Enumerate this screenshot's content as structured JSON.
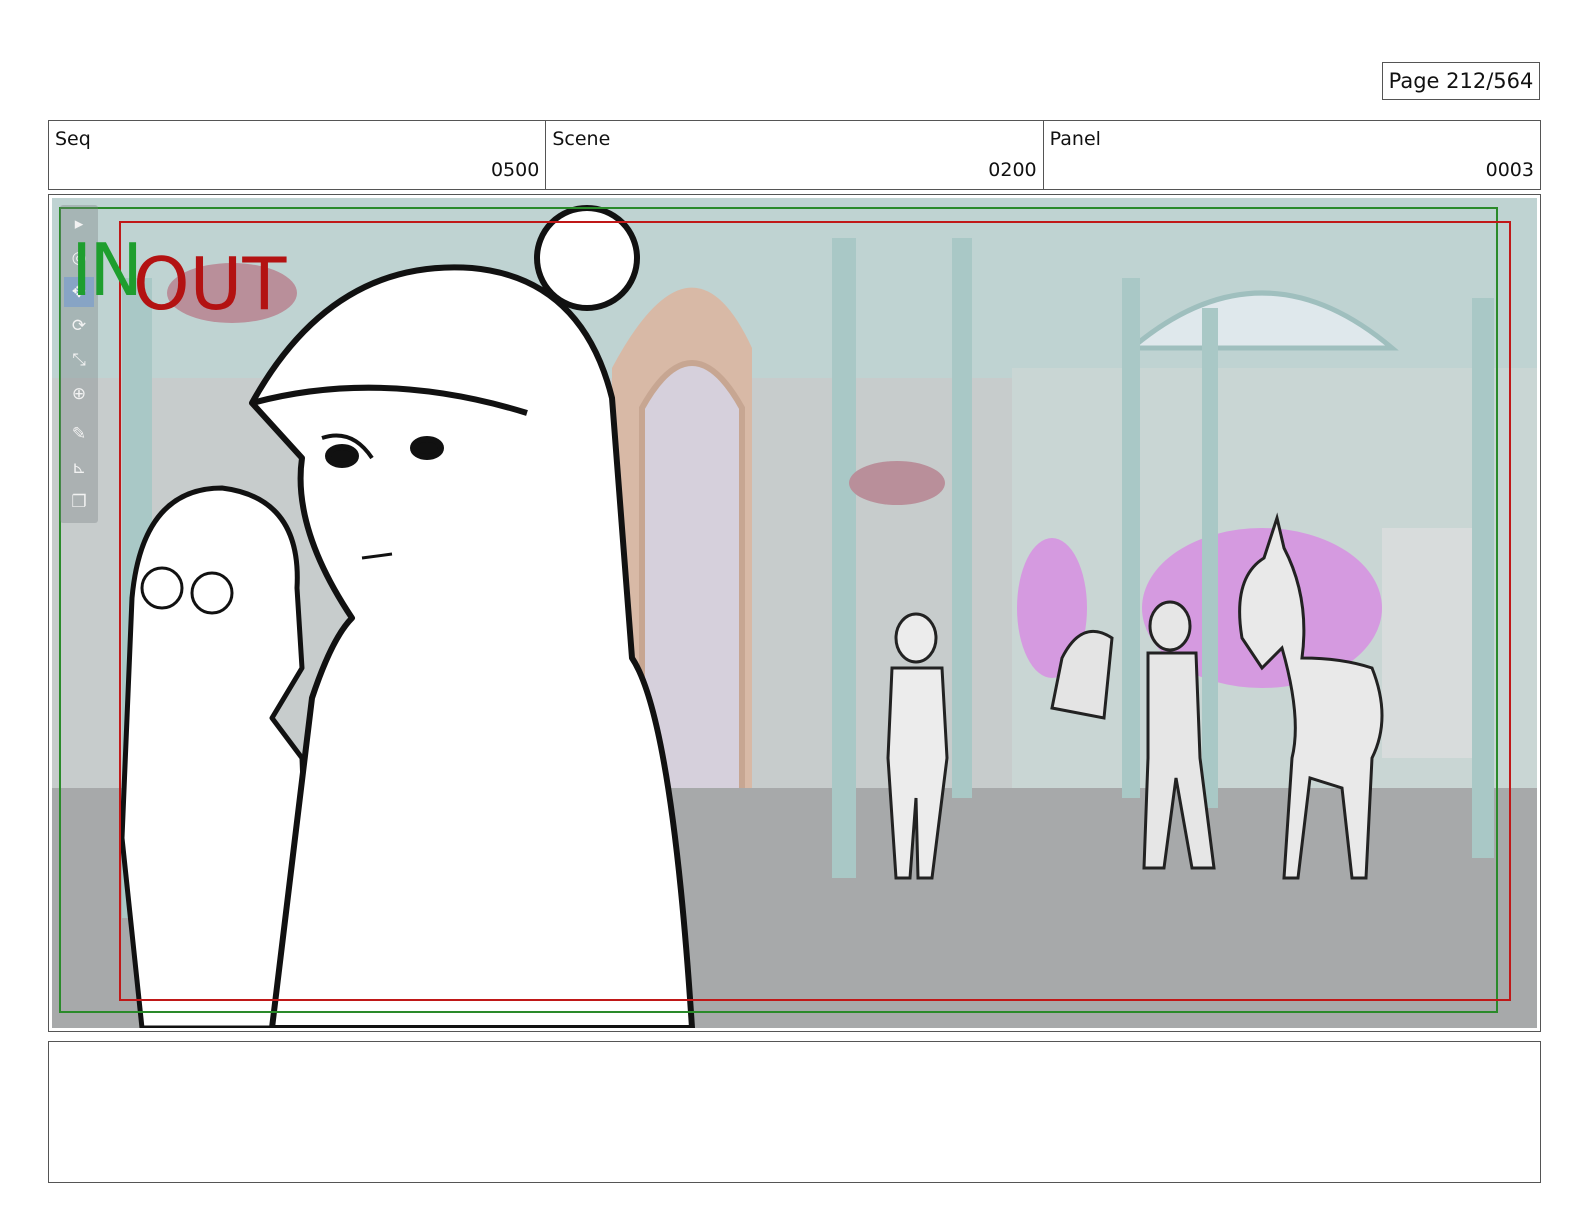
{
  "page": {
    "label": "Page 212/564"
  },
  "header": {
    "seq": {
      "label": "Seq",
      "value": "0500"
    },
    "scene": {
      "label": "Scene",
      "value": "0200"
    },
    "panel": {
      "label": "Panel",
      "value": "0003"
    }
  },
  "overlay": {
    "in_marker": "IN",
    "out_marker": "OUT",
    "colors": {
      "in": "#1e9e2e",
      "out": "#b31212",
      "safe_frame_green": "#2a8a2a",
      "safe_frame_red": "#c01818"
    }
  },
  "toolbar": {
    "tools": [
      {
        "icon": "select-icon",
        "glyph": "▸"
      },
      {
        "icon": "camera-icon",
        "glyph": "◎"
      },
      {
        "icon": "move-icon",
        "glyph": "✥"
      },
      {
        "icon": "rotate-icon",
        "glyph": "⟳"
      },
      {
        "icon": "scale-icon",
        "glyph": "⤡"
      },
      {
        "icon": "pivot-icon",
        "glyph": "⊕"
      },
      {
        "icon": "brush-icon",
        "glyph": "✎"
      },
      {
        "icon": "ruler-icon",
        "glyph": "⊾"
      },
      {
        "icon": "layer-icon",
        "glyph": "❐"
      }
    ]
  },
  "notes": {
    "text": ""
  }
}
